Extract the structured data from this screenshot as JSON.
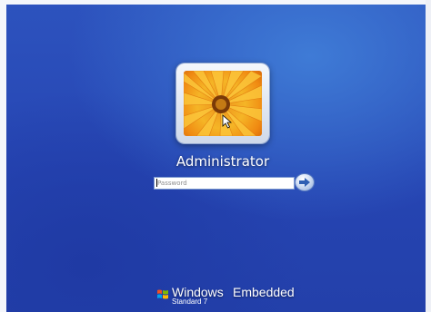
{
  "login": {
    "username": "Administrator",
    "password_placeholder": "Password",
    "submit_icon": "arrow-right-icon"
  },
  "user_tile": {
    "picture": "orange-flower-picture"
  },
  "brand": {
    "name": "Windows",
    "product": "Embedded",
    "edition": "Standard 7"
  },
  "colors": {
    "background": "#2a4bb8",
    "accent": "#f5b526"
  }
}
